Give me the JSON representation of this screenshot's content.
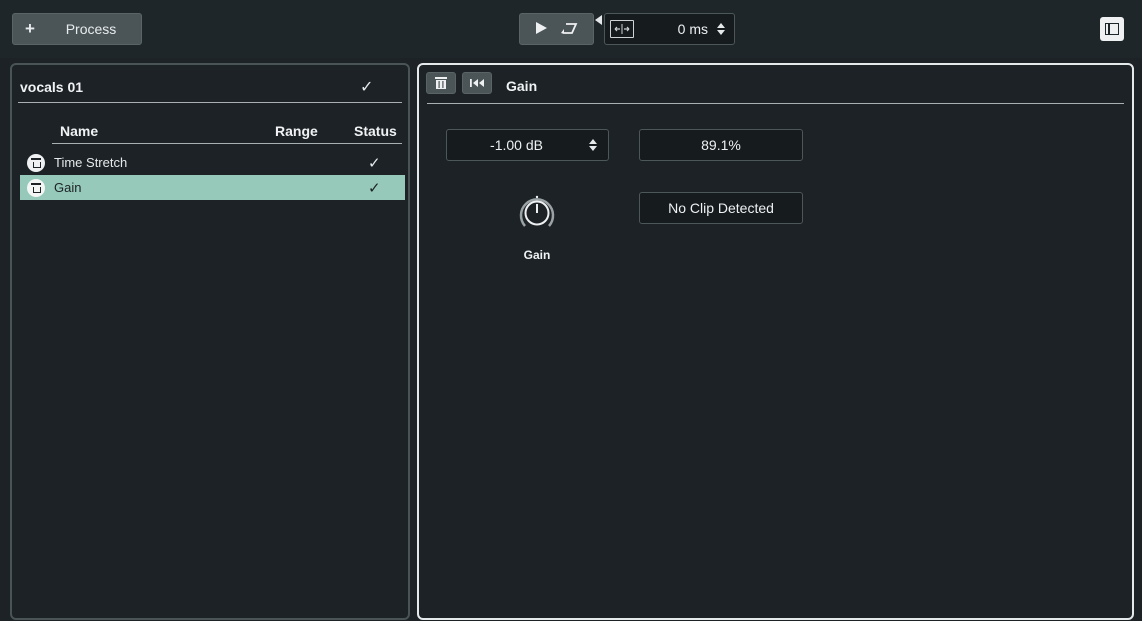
{
  "toolbar": {
    "process_plus": "+",
    "process_label": "Process",
    "fade_value": "0 ms"
  },
  "list": {
    "title": "vocals 01",
    "headers": {
      "name": "Name",
      "range": "Range",
      "status": "Status"
    },
    "items": [
      {
        "name": "Time Stretch",
        "range": "",
        "status": "✓",
        "selected": false
      },
      {
        "name": "Gain",
        "range": "",
        "status": "✓",
        "selected": true
      }
    ]
  },
  "editor": {
    "title": "Gain",
    "gain_value": "-1.00 dB",
    "percent_value": "89.1%",
    "clip_status": "No Clip Detected",
    "knob_label": "Gain"
  },
  "colors": {
    "selection": "#96c9b9",
    "active_border": "#e6e9ea"
  }
}
